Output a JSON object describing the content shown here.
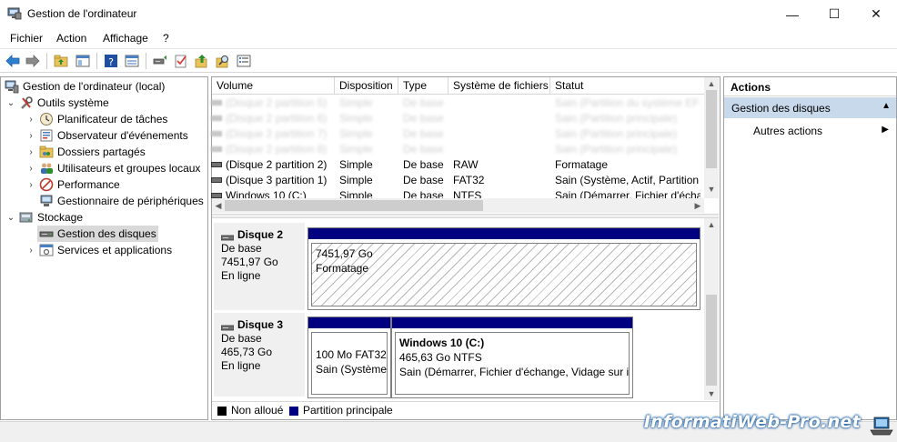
{
  "window": {
    "title": "Gestion de l'ordinateur",
    "controls": {
      "minimize": "—",
      "maximize": "☐",
      "close": "✕"
    }
  },
  "menu": {
    "items": [
      {
        "label": "Fichier"
      },
      {
        "label": "Action"
      },
      {
        "label": "Affichage"
      },
      {
        "label": "?"
      }
    ]
  },
  "toolbar": {
    "icons": [
      "back-arrow-icon",
      "forward-arrow-icon",
      "up-folder-icon",
      "show-hide-tree-icon",
      "help-icon",
      "properties-icon",
      "connect-icon",
      "checklist-icon",
      "export-icon",
      "search-icon",
      "list-icon"
    ]
  },
  "tree": {
    "root": "Gestion de l'ordinateur (local)",
    "system_tools": "Outils système",
    "task_scheduler": "Planificateur de tâches",
    "event_viewer": "Observateur d'événements",
    "shared_folders": "Dossiers partagés",
    "local_users": "Utilisateurs et groupes locaux",
    "performance": "Performance",
    "device_manager": "Gestionnaire de périphériques",
    "storage": "Stockage",
    "disk_management": "Gestion des disques",
    "services": "Services et applications"
  },
  "volumes": {
    "columns": [
      "Volume",
      "Disposition",
      "Type",
      "Système de fichiers",
      "Statut"
    ],
    "rows": [
      {
        "volume": "(Disque 2 partition 5)",
        "layout": "Simple",
        "type": "De base",
        "fs": "",
        "status": "Sain (Partition du système EFI)",
        "blurred": true
      },
      {
        "volume": "(Disque 2 partition 6)",
        "layout": "Simple",
        "type": "De base",
        "fs": "",
        "status": "Sain (Partition principale)",
        "blurred": true
      },
      {
        "volume": "(Disque 2 partition 7)",
        "layout": "Simple",
        "type": "De base",
        "fs": "",
        "status": "Sain (Partition principale)",
        "blurred": true
      },
      {
        "volume": "(Disque 2 partition 8)",
        "layout": "Simple",
        "type": "De base",
        "fs": "",
        "status": "Sain (Partition principale)",
        "blurred": true
      },
      {
        "volume": "(Disque 2 partition 2)",
        "layout": "Simple",
        "type": "De base",
        "fs": "RAW",
        "status": "Formatage",
        "blurred": false
      },
      {
        "volume": "(Disque 3 partition 1)",
        "layout": "Simple",
        "type": "De base",
        "fs": "FAT32",
        "status": "Sain (Système, Actif, Partition p",
        "blurred": false
      },
      {
        "volume": "Windows 10 (C:)",
        "layout": "Simple",
        "type": "De base",
        "fs": "NTFS",
        "status": "Sain (Démarrer, Fichier d'échange",
        "blurred": false
      }
    ]
  },
  "disks": {
    "disk2": {
      "name": "Disque 2",
      "type": "De base",
      "size": "7451,97 Go",
      "state": "En ligne",
      "partition": {
        "size": "7451,97 Go",
        "status": "Formatage"
      }
    },
    "disk3": {
      "name": "Disque 3",
      "type": "De base",
      "size": "465,73 Go",
      "state": "En ligne",
      "part1": {
        "line1": "100 Mo FAT32",
        "line2": "Sain (Système,"
      },
      "part2": {
        "title": "Windows 10  (C:)",
        "line1": "465,63 Go NTFS",
        "line2": "Sain (Démarrer, Fichier d'échange, Vidage sur ir"
      }
    }
  },
  "legend": {
    "unallocated": "Non alloué",
    "primary": "Partition principale",
    "colors": {
      "unallocated": "#000000",
      "primary": "#000080"
    }
  },
  "actions": {
    "header": "Actions",
    "section": "Gestion des disques",
    "more": "Autres actions"
  },
  "watermark": "InformatiWeb-Pro.net",
  "colors": {
    "selection": "#d9d9d9",
    "actions_section": "#c9d9ec",
    "partition_bar": "#000080"
  }
}
